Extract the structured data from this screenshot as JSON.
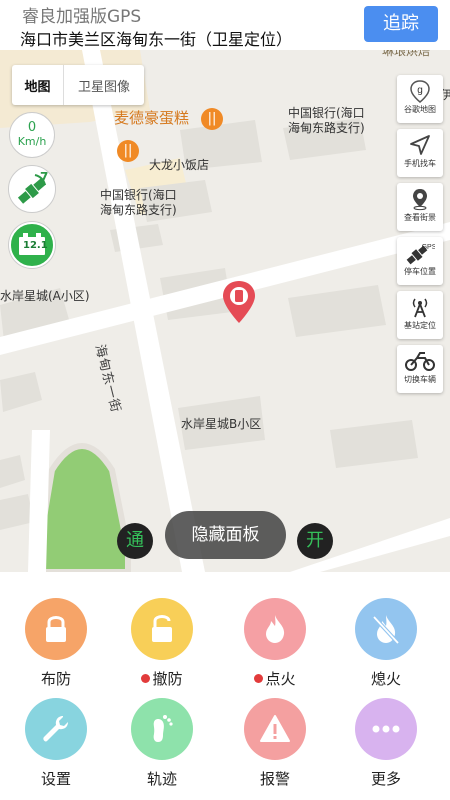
{
  "header": {
    "app_title": "睿良加强版GPS",
    "address": "海口市美兰区海甸东一街（卫星定位）",
    "track_button": "追踪"
  },
  "map": {
    "map_type": {
      "map": "地图",
      "satellite": "卫星图像"
    },
    "speed": {
      "value": "0",
      "unit": "Km/h"
    },
    "gps_signal": "7",
    "battery": "12.1",
    "labels": {
      "cake_shop": "麦德豪蛋糕",
      "restaurant": "大龙小饭店",
      "bank_top_right_line1": "中国银行(海口",
      "bank_top_right_line2": "海甸东路支行)",
      "bank_left_line1": "中国银行(海口",
      "bank_left_line2": "海甸东路支行)",
      "street": "海甸东一街",
      "community_a": "水岸星城(A小区)",
      "community_b": "水岸星城B小区",
      "top_edge": "琳琅烘焙",
      "right_edge": "伊"
    },
    "tools": [
      {
        "label": "谷歌地图",
        "icon": "google-maps-icon"
      },
      {
        "label": "手机找车",
        "icon": "navigation-arrow-icon"
      },
      {
        "label": "查看街景",
        "icon": "street-view-pin-icon"
      },
      {
        "label": "停车位置",
        "icon": "gps-satellite-icon"
      },
      {
        "label": "基站定位",
        "icon": "cell-tower-icon"
      },
      {
        "label": "切换车辆",
        "icon": "motorcycle-icon"
      }
    ],
    "hide_panel": "隐藏面板",
    "left_toggle": "通",
    "right_toggle": "开"
  },
  "controls": [
    {
      "label": "布防",
      "dot": false,
      "color": "#f6a468",
      "icon": "lock-icon"
    },
    {
      "label": "撤防",
      "dot": true,
      "color": "#f8cf58",
      "icon": "unlock-icon"
    },
    {
      "label": "点火",
      "dot": true,
      "color": "#f5a0a4",
      "icon": "flame-icon"
    },
    {
      "label": "熄火",
      "dot": false,
      "color": "#93c5ef",
      "icon": "flame-off-icon"
    },
    {
      "label": "设置",
      "dot": false,
      "color": "#88d4df",
      "icon": "wrench-icon"
    },
    {
      "label": "轨迹",
      "dot": false,
      "color": "#8ee2ab",
      "icon": "footprint-icon"
    },
    {
      "label": "报警",
      "dot": false,
      "color": "#f4a0a0",
      "icon": "warning-icon"
    },
    {
      "label": "更多",
      "dot": false,
      "color": "#d8b3ef",
      "icon": "more-icon"
    }
  ]
}
